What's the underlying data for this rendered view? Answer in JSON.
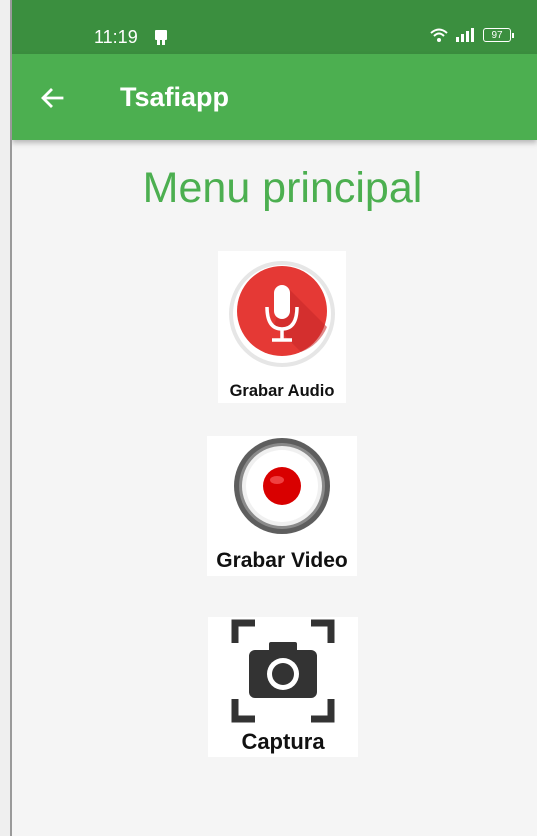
{
  "status_bar": {
    "time": "11:19",
    "battery": "97"
  },
  "app_bar": {
    "title": "Tsafiapp"
  },
  "main": {
    "heading": "Menu principal",
    "items": [
      {
        "label": "Grabar Audio",
        "icon": "microphone-icon"
      },
      {
        "label": "Grabar Video",
        "icon": "record-icon"
      },
      {
        "label": "Captura",
        "icon": "camera-capture-icon"
      }
    ]
  },
  "colors": {
    "status_bar": "#3b8f3f",
    "app_bar": "#4caf50",
    "accent_text": "#4caf50",
    "mic_red": "#e53935",
    "record_red": "#d90000"
  }
}
